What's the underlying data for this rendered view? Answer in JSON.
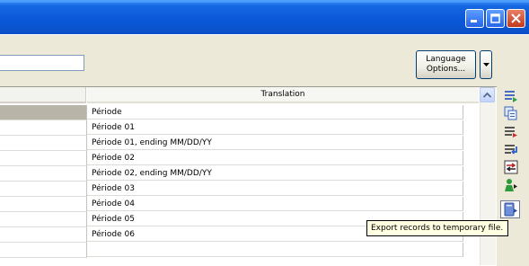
{
  "window": {
    "controls": [
      "minimize-icon",
      "maximize-icon",
      "close-icon"
    ]
  },
  "toolbar": {
    "search_value": "",
    "language_button_line1": "Language",
    "language_button_line2": "Options..."
  },
  "grid": {
    "columns": [
      "",
      "Translation"
    ],
    "rows": [
      "Période",
      "Période 01",
      "Période 01, ending MM/DD/YY",
      "Période 02",
      "Période 02, ending MM/DD/YY",
      "Période 03",
      "Période 04",
      "Période 05",
      "Période 06"
    ]
  },
  "side_toolbar": {
    "icons": [
      "insert-record-icon",
      "copy-records-icon",
      "delete-record-icon",
      "import-records-icon",
      "replace-icon",
      "user-export-icon",
      "export-temp-file-icon"
    ]
  },
  "tooltip": {
    "text": "Export records to temporary file."
  },
  "colors": {
    "titlebar": "#0a58d8",
    "selected_row_cell": "#b8b4a8",
    "tooltip_bg": "#ffffe1"
  }
}
